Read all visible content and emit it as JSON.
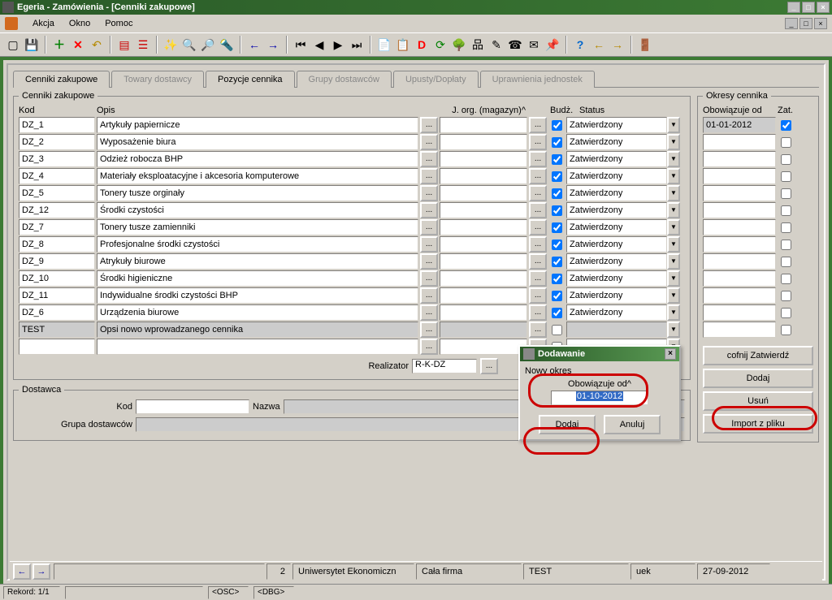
{
  "window": {
    "title": "Egeria - Zamówienia - [Cenniki zakupowe]"
  },
  "menu": {
    "akcja": "Akcja",
    "okno": "Okno",
    "pomoc": "Pomoc"
  },
  "tabs": {
    "cenniki": "Cenniki zakupowe",
    "towary": "Towary dostawcy",
    "pozycje": "Pozycje cennika",
    "grupy": "Grupy dostawców",
    "upusty": "Upusty/Dopłaty",
    "uprawnienia": "Uprawnienia jednostek"
  },
  "group": {
    "cenniki": "Cenniki zakupowe",
    "okresy": "Okresy cennika",
    "dostawca": "Dostawca"
  },
  "headers": {
    "kod": "Kod",
    "opis": "Opis",
    "jorg": "J. org. (magazyn)^",
    "budz": "Budż.",
    "status": "Status",
    "obowiazuje": "Obowiązuje od",
    "zat": "Zat."
  },
  "rows": [
    {
      "kod": "DZ_1",
      "opis": "Artykuły papiernicze",
      "jorg": "",
      "budz": true,
      "status": "Zatwierdzony"
    },
    {
      "kod": "DZ_2",
      "opis": "Wyposażenie biura",
      "jorg": "",
      "budz": true,
      "status": "Zatwierdzony"
    },
    {
      "kod": "DZ_3",
      "opis": "Odzież robocza BHP",
      "jorg": "",
      "budz": true,
      "status": "Zatwierdzony"
    },
    {
      "kod": "DZ_4",
      "opis": "Materiały eksploatacyjne i akcesoria komputerowe",
      "jorg": "",
      "budz": true,
      "status": "Zatwierdzony"
    },
    {
      "kod": "DZ_5",
      "opis": "Tonery tusze orginały",
      "jorg": "",
      "budz": true,
      "status": "Zatwierdzony"
    },
    {
      "kod": "DZ_12",
      "opis": "Środki czystości",
      "jorg": "",
      "budz": true,
      "status": "Zatwierdzony"
    },
    {
      "kod": "DZ_7",
      "opis": "Tonery tusze zamienniki",
      "jorg": "",
      "budz": true,
      "status": "Zatwierdzony"
    },
    {
      "kod": "DZ_8",
      "opis": "Profesjonalne środki czystości",
      "jorg": "",
      "budz": true,
      "status": "Zatwierdzony"
    },
    {
      "kod": "DZ_9",
      "opis": "Atrykuły biurowe",
      "jorg": "",
      "budz": true,
      "status": "Zatwierdzony"
    },
    {
      "kod": "DZ_10",
      "opis": "Środki higieniczne",
      "jorg": "",
      "budz": true,
      "status": "Zatwierdzony"
    },
    {
      "kod": "DZ_11",
      "opis": "Indywidualne środki czystości BHP",
      "jorg": "",
      "budz": true,
      "status": "Zatwierdzony"
    },
    {
      "kod": "DZ_6",
      "opis": "Urządzenia biurowe",
      "jorg": "",
      "budz": true,
      "status": "Zatwierdzony"
    },
    {
      "kod": "TEST",
      "opis": "Opsi nowo wprowadzanego cennika",
      "jorg": "",
      "budz": false,
      "status": "",
      "highlighted": true,
      "yellow_jorg": true
    }
  ],
  "okresy": [
    {
      "date": "01-01-2012",
      "zat": true
    },
    {
      "date": "",
      "zat": false
    },
    {
      "date": "",
      "zat": false
    },
    {
      "date": "",
      "zat": false
    },
    {
      "date": "",
      "zat": false
    },
    {
      "date": "",
      "zat": false
    },
    {
      "date": "",
      "zat": false
    },
    {
      "date": "",
      "zat": false
    },
    {
      "date": "",
      "zat": false
    },
    {
      "date": "",
      "zat": false
    },
    {
      "date": "",
      "zat": false
    },
    {
      "date": "",
      "zat": false
    },
    {
      "date": "",
      "zat": false
    }
  ],
  "side_buttons": {
    "cofnij": "cofnij Zatwierdź",
    "dodaj": "Dodaj",
    "usun": "Usuń",
    "import": "Import z pliku"
  },
  "dostawca": {
    "kod_label": "Kod",
    "kod_value": "",
    "nazwa_label": "Nazwa",
    "nazwa_value": "",
    "grupa_label": "Grupa dostawców",
    "grupa_value": ""
  },
  "realizator": {
    "label": "Realizator",
    "value": "R-K-DZ"
  },
  "dialog": {
    "title": "Dodawanie",
    "nowy": "Nowy okres",
    "ob_label": "Obowiązuje od^",
    "ob_value": "01-10-2012",
    "dodaj": "Dodaj",
    "anuluj": "Anuluj"
  },
  "statusbar": {
    "c1": "",
    "c2": "2",
    "c3": "Uniwersytet Ekonomiczn",
    "c4": "Cała firma",
    "c5": "TEST",
    "c6": "uek",
    "c7": "27-09-2012"
  },
  "bottom": {
    "rekord": "Rekord: 1/1",
    "osc": "<OSC>",
    "dbg": "<DBG>"
  },
  "glyphs": {
    "ellipsis": "..."
  }
}
